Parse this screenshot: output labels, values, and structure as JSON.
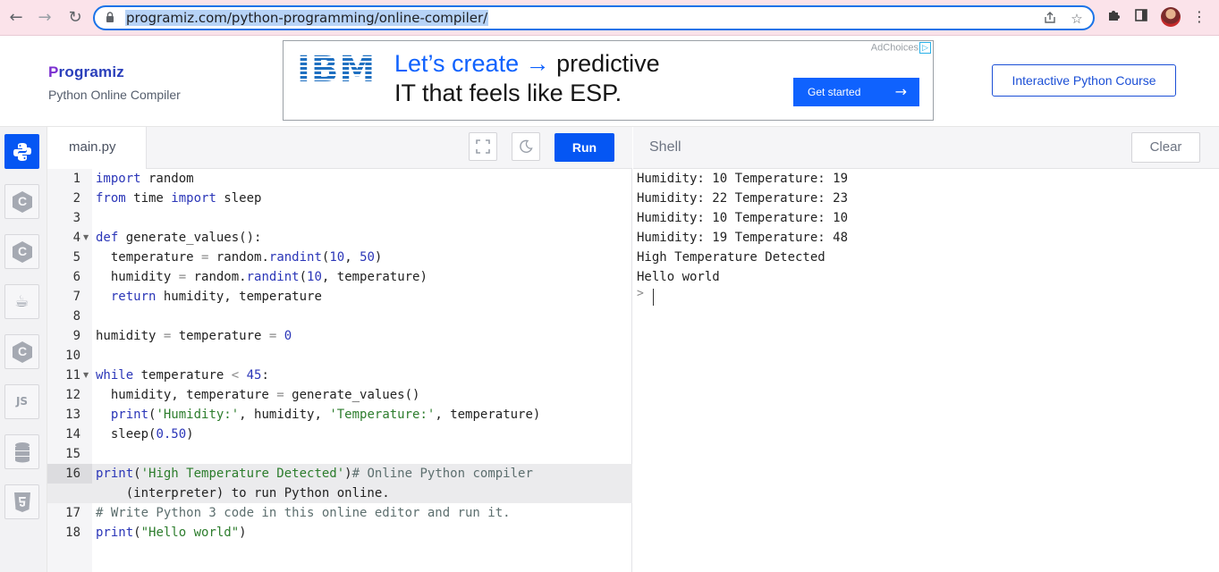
{
  "browser": {
    "url": "programiz.com/python-programming/online-compiler/",
    "back_icon": "←",
    "forward_icon": "→",
    "reload_icon": "↻"
  },
  "header": {
    "logo_text": "rogramiz",
    "logo_initial": "P",
    "subtitle": "Python Online Compiler",
    "course_button": "Interactive Python Course"
  },
  "ad": {
    "adchoices": "AdChoices",
    "brand": "IBM",
    "line1_blue": "Let’s create",
    "line1_rest": "predictive",
    "line2": "IT that feels like ESP.",
    "cta": "Get started"
  },
  "editor": {
    "tab_name": "main.py",
    "run_label": "Run"
  },
  "shell": {
    "title": "Shell",
    "clear_label": "Clear",
    "output": [
      "Humidity: 10 Temperature: 19",
      "Humidity: 22 Temperature: 23",
      "Humidity: 10 Temperature: 10",
      "Humidity: 19 Temperature: 48",
      "High Temperature Detected",
      "Hello world"
    ],
    "prompt": ">"
  },
  "sidebar": {
    "languages": [
      "python",
      "c",
      "cpp",
      "java",
      "csharp",
      "js",
      "sql",
      "html"
    ],
    "js_label": "JS"
  },
  "code_lines": [
    {
      "n": "1",
      "text": "import random"
    },
    {
      "n": "2",
      "text": "from time import sleep"
    },
    {
      "n": "3",
      "text": ""
    },
    {
      "n": "4",
      "text": "def generate_values():"
    },
    {
      "n": "5",
      "text": "  temperature = random.randint(10, 50)"
    },
    {
      "n": "6",
      "text": "  humidity = random.randint(10, temperature)"
    },
    {
      "n": "7",
      "text": "  return humidity, temperature"
    },
    {
      "n": "8",
      "text": ""
    },
    {
      "n": "9",
      "text": "humidity = temperature = 0"
    },
    {
      "n": "10",
      "text": ""
    },
    {
      "n": "11",
      "text": "while temperature < 45:"
    },
    {
      "n": "12",
      "text": "  humidity, temperature = generate_values()"
    },
    {
      "n": "13",
      "text": "  print('Humidity:', humidity, 'Temperature:', temperature)"
    },
    {
      "n": "14",
      "text": "  sleep(0.50)"
    },
    {
      "n": "15",
      "text": ""
    },
    {
      "n": "16",
      "text": "print('High Temperature Detected')# Online Python compiler"
    },
    {
      "n": "",
      "text": "    (interpreter) to run Python online."
    },
    {
      "n": "17",
      "text": "# Write Python 3 code in this online editor and run it."
    },
    {
      "n": "18",
      "text": "print(\"Hello world\")"
    }
  ]
}
